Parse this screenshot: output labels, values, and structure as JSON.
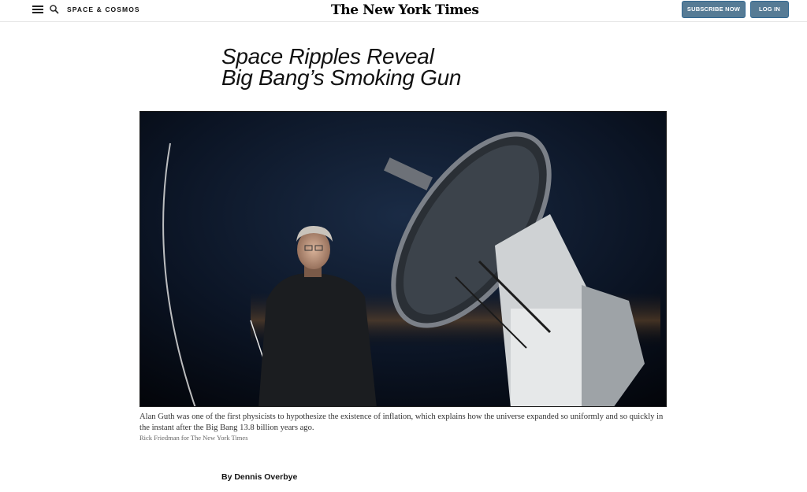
{
  "header": {
    "section": "SPACE & COSMOS",
    "logo": "The New York Times",
    "subscribe_label": "SUBSCRIBE NOW",
    "login_label": "LOG IN",
    "accent_color": "#567b95"
  },
  "article": {
    "headline_line1": "Space Ripples Reveal",
    "headline_line2": "Big Bang’s Smoking Gun",
    "caption": "Alan Guth was one of the first physicists to hypothesize the existence of inflation, which explains how the universe expanded so uniformly and so quickly in the instant after the Big Bang 13.8 billion years ago.",
    "credit": "Rick Friedman for The New York Times",
    "byline_prefix": "By ",
    "author": "Dennis Overbye"
  },
  "icons": {
    "menu": "hamburger-menu-icon",
    "search": "search-icon"
  }
}
